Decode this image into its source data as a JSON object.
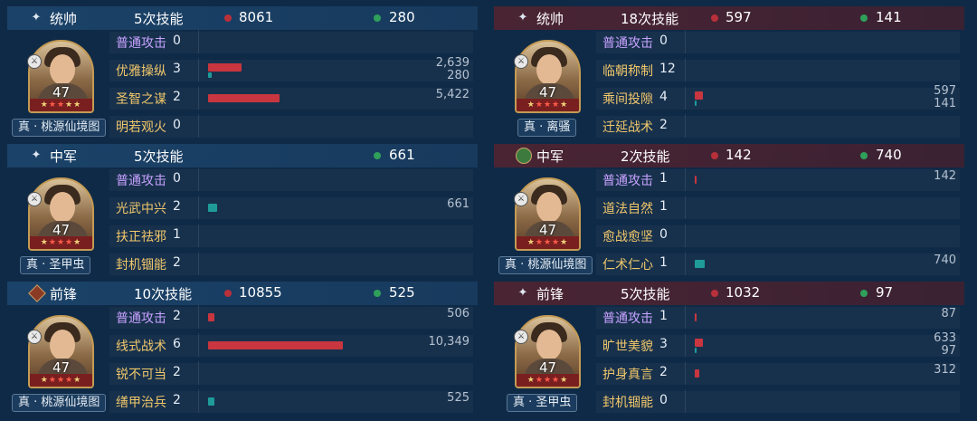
{
  "colors": {
    "damage": "#c9363f",
    "heal": "#1f9c9a",
    "basic_skill": "#c8a2ff",
    "skill": "#f1c76a"
  },
  "panels": [
    {
      "side": "left",
      "role": "统帅",
      "role_icon": "sparkle-icon",
      "skill_count": "5次技能",
      "damage": "8061",
      "heal": "280",
      "level": "47",
      "stars": 5,
      "red_stars": 2,
      "tag": "真 · 桃源仙境图",
      "skills": [
        {
          "name": "普通攻击",
          "count": "0",
          "basic": true,
          "dmg_frac": 0,
          "heal_frac": 0,
          "dmg_text": "",
          "heal_text": ""
        },
        {
          "name": "优雅操纵",
          "count": "3",
          "basic": false,
          "dmg_frac": 0.09,
          "heal_frac": 0.01,
          "dmg_text": "2,639",
          "heal_text": "280"
        },
        {
          "name": "圣智之谋",
          "count": "2",
          "basic": false,
          "dmg_frac": 0.19,
          "heal_frac": 0,
          "dmg_text": "5,422",
          "heal_text": ""
        },
        {
          "name": "明若观火",
          "count": "0",
          "basic": false,
          "dmg_frac": 0,
          "heal_frac": 0,
          "dmg_text": "",
          "heal_text": ""
        }
      ]
    },
    {
      "side": "left",
      "role": "中军",
      "role_icon": "sparkle-icon",
      "skill_count": "5次技能",
      "damage": "",
      "heal": "661",
      "level": "47",
      "stars": 5,
      "red_stars": 3,
      "tag": "真 · 圣甲虫",
      "skills": [
        {
          "name": "普通攻击",
          "count": "0",
          "basic": true,
          "dmg_frac": 0,
          "heal_frac": 0,
          "dmg_text": "",
          "heal_text": ""
        },
        {
          "name": "光武中兴",
          "count": "2",
          "basic": false,
          "dmg_frac": 0,
          "heal_frac": 0.024,
          "dmg_text": "",
          "heal_text": "661"
        },
        {
          "name": "扶正祛邪",
          "count": "1",
          "basic": false,
          "dmg_frac": 0,
          "heal_frac": 0,
          "dmg_text": "",
          "heal_text": ""
        },
        {
          "name": "封机锢能",
          "count": "2",
          "basic": false,
          "dmg_frac": 0,
          "heal_frac": 0,
          "dmg_text": "",
          "heal_text": ""
        }
      ]
    },
    {
      "side": "left",
      "role": "前锋",
      "role_icon": "sword-icon",
      "skill_count": "10次技能",
      "damage": "10855",
      "heal": "525",
      "level": "47",
      "stars": 5,
      "red_stars": 3,
      "tag": "真 · 桃源仙境图",
      "skills": [
        {
          "name": "普通攻击",
          "count": "2",
          "basic": true,
          "dmg_frac": 0.018,
          "heal_frac": 0,
          "dmg_text": "506",
          "heal_text": ""
        },
        {
          "name": "线式战术",
          "count": "6",
          "basic": false,
          "dmg_frac": 0.36,
          "heal_frac": 0,
          "dmg_text": "10,349",
          "heal_text": ""
        },
        {
          "name": "锐不可当",
          "count": "2",
          "basic": false,
          "dmg_frac": 0,
          "heal_frac": 0,
          "dmg_text": "",
          "heal_text": ""
        },
        {
          "name": "缮甲治兵",
          "count": "2",
          "basic": false,
          "dmg_frac": 0,
          "heal_frac": 0.018,
          "dmg_text": "",
          "heal_text": "525"
        }
      ]
    },
    {
      "side": "right",
      "role": "统帅",
      "role_icon": "sparkle-icon",
      "skill_count": "18次技能",
      "damage": "597",
      "heal": "141",
      "level": "47",
      "stars": 5,
      "red_stars": 3,
      "tag": "真 · 离骚",
      "skills": [
        {
          "name": "普通攻击",
          "count": "0",
          "basic": true,
          "dmg_frac": 0,
          "heal_frac": 0,
          "dmg_text": "",
          "heal_text": ""
        },
        {
          "name": "临朝称制",
          "count": "12",
          "basic": false,
          "dmg_frac": 0,
          "heal_frac": 0,
          "dmg_text": "",
          "heal_text": ""
        },
        {
          "name": "乘间投隙",
          "count": "4",
          "basic": false,
          "dmg_frac": 0.021,
          "heal_frac": 0.005,
          "dmg_text": "597",
          "heal_text": "141"
        },
        {
          "name": "迁延战术",
          "count": "2",
          "basic": false,
          "dmg_frac": 0,
          "heal_frac": 0,
          "dmg_text": "",
          "heal_text": ""
        }
      ]
    },
    {
      "side": "right",
      "role": "中军",
      "role_icon": "heart-icon",
      "skill_count": "2次技能",
      "damage": "142",
      "heal": "740",
      "level": "47",
      "stars": 5,
      "red_stars": 3,
      "tag": "真 · 桃源仙境图",
      "skills": [
        {
          "name": "普通攻击",
          "count": "1",
          "basic": true,
          "dmg_frac": 0.005,
          "heal_frac": 0,
          "dmg_text": "142",
          "heal_text": ""
        },
        {
          "name": "道法自然",
          "count": "1",
          "basic": false,
          "dmg_frac": 0,
          "heal_frac": 0,
          "dmg_text": "",
          "heal_text": ""
        },
        {
          "name": "愈战愈坚",
          "count": "0",
          "basic": false,
          "dmg_frac": 0,
          "heal_frac": 0,
          "dmg_text": "",
          "heal_text": ""
        },
        {
          "name": "仁术仁心",
          "count": "1",
          "basic": false,
          "dmg_frac": 0,
          "heal_frac": 0.027,
          "dmg_text": "",
          "heal_text": "740"
        }
      ]
    },
    {
      "side": "right",
      "role": "前锋",
      "role_icon": "sparkle-icon",
      "skill_count": "5次技能",
      "damage": "1032",
      "heal": "97",
      "level": "47",
      "stars": 5,
      "red_stars": 3,
      "tag": "真 · 圣甲虫",
      "skills": [
        {
          "name": "普通攻击",
          "count": "1",
          "basic": true,
          "dmg_frac": 0.003,
          "heal_frac": 0,
          "dmg_text": "87",
          "heal_text": ""
        },
        {
          "name": "旷世美貌",
          "count": "3",
          "basic": false,
          "dmg_frac": 0.022,
          "heal_frac": 0.003,
          "dmg_text": "633",
          "heal_text": "97"
        },
        {
          "name": "护身真言",
          "count": "2",
          "basic": false,
          "dmg_frac": 0.011,
          "heal_frac": 0,
          "dmg_text": "312",
          "heal_text": ""
        },
        {
          "name": "封机锢能",
          "count": "0",
          "basic": false,
          "dmg_frac": 0,
          "heal_frac": 0,
          "dmg_text": "",
          "heal_text": ""
        }
      ]
    }
  ]
}
